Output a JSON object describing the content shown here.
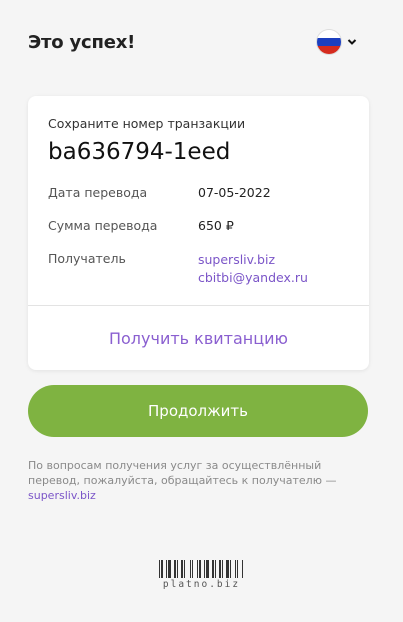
{
  "header": {
    "title": "Это успех!",
    "language_flag": "russia-flag-icon"
  },
  "card": {
    "save_label": "Сохраните номер транзакции",
    "transaction_id": "ba636794-1eed",
    "rows": [
      {
        "label": "Дата перевода",
        "value": "07-05-2022"
      },
      {
        "label": "Сумма перевода",
        "value": "650 ₽"
      },
      {
        "label": "Получатель",
        "links": [
          "supersliv.biz",
          "cbitbi@yandex.ru"
        ]
      }
    ],
    "receipt_label": "Получить квитанцию"
  },
  "continue_label": "Продолжить",
  "note": {
    "text": "По вопросам получения услуг за осуществлённый перевод, пожалуйста, обращайтесь к получателю —",
    "link": "supersliv.biz"
  },
  "footer": {
    "brand": "platno.biz"
  },
  "colors": {
    "accent_green": "#7fb341",
    "link_purple": "#7b55c8",
    "receipt_purple": "#8a5fd0",
    "background": "#f5f5f5"
  }
}
